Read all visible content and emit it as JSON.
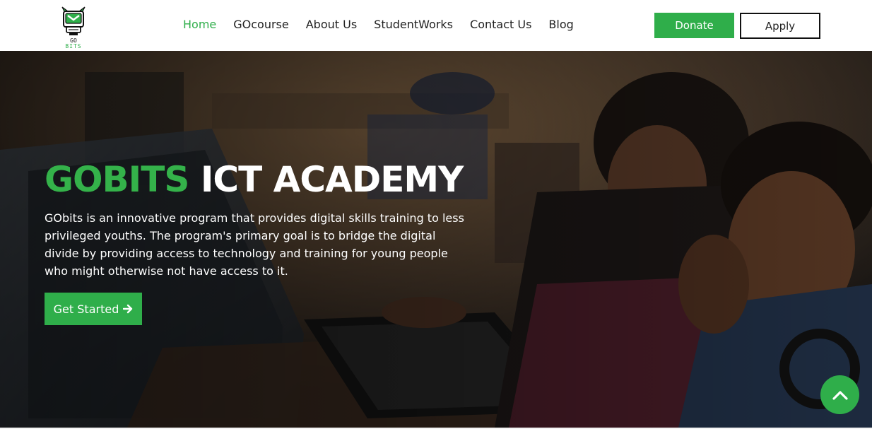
{
  "brand": {
    "logo_top": "GO",
    "logo_bottom": "BITS"
  },
  "nav": {
    "items": [
      {
        "label": "Home",
        "active": true
      },
      {
        "label": "GOcourse"
      },
      {
        "label": "About Us"
      },
      {
        "label": "StudentWorks"
      },
      {
        "label": "Contact Us"
      },
      {
        "label": "Blog"
      }
    ]
  },
  "header": {
    "donate_label": "Donate",
    "apply_label": "Apply"
  },
  "hero": {
    "title_highlight": "GOBITS",
    "title_rest": "ICT ACADEMY",
    "description": "GObits is an innovative program that provides digital skills training to less privileged youths. The program's primary goal is to bridge the digital divide by providing access to technology and training for young people who might otherwise not have access to it.",
    "cta_label": "Get Started"
  },
  "icons": {
    "cta_arrow": "arrow-right-icon",
    "scroll_top": "chevron-up-icon"
  },
  "colors": {
    "accent": "#2fae4a",
    "title_green": "#34b24a",
    "nav_text": "#222222"
  }
}
